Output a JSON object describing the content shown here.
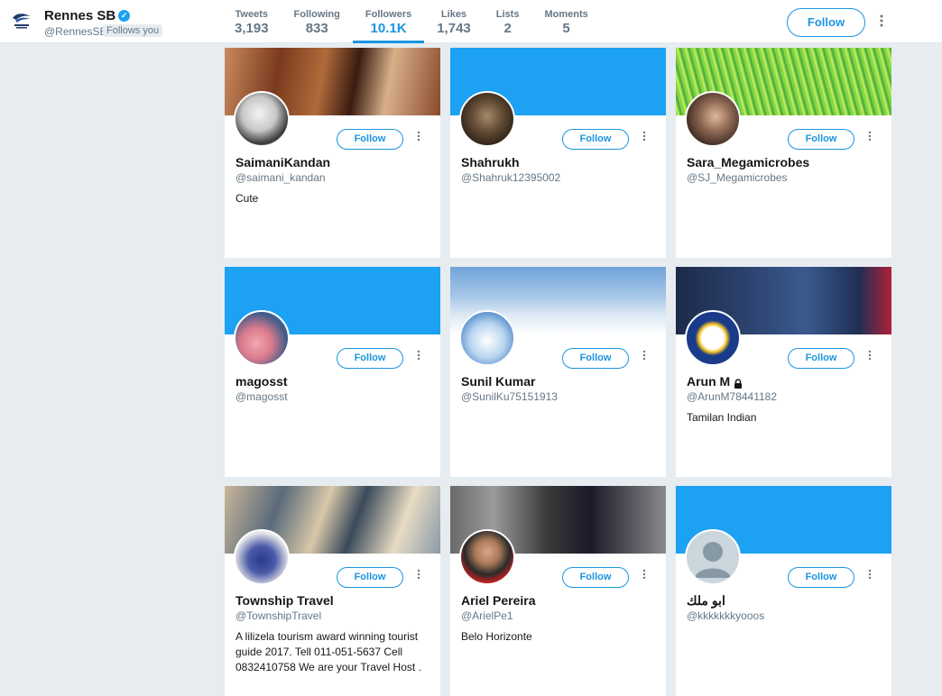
{
  "header": {
    "profile_name": "Rennes SB",
    "profile_handle": "@RennesSB",
    "follows_you": "Follows you",
    "follow_label": "Follow",
    "stats": [
      {
        "label": "Tweets",
        "value": "3,193"
      },
      {
        "label": "Following",
        "value": "833"
      },
      {
        "label": "Followers",
        "value": "10.1K"
      },
      {
        "label": "Likes",
        "value": "1,743"
      },
      {
        "label": "Lists",
        "value": "2"
      },
      {
        "label": "Moments",
        "value": "5"
      }
    ],
    "active_stat": "Followers"
  },
  "colors": {
    "accent": "#1b95e0",
    "default_banner": "#1da1f2",
    "page_bg": "#e6ecf0"
  },
  "cards": [
    {
      "name": "SaimaniKandan",
      "handle": "@saimani_kandan",
      "bio": "Cute",
      "follow": "Follow",
      "locked": false
    },
    {
      "name": "Shahrukh",
      "handle": "@Shahruk12395002",
      "bio": "",
      "follow": "Follow",
      "locked": false
    },
    {
      "name": "Sara_Megamicrobes",
      "handle": "@SJ_Megamicrobes",
      "bio": "",
      "follow": "Follow",
      "locked": false
    },
    {
      "name": "magosst",
      "handle": "@magosst",
      "bio": "",
      "follow": "Follow",
      "locked": false
    },
    {
      "name": "Sunil Kumar",
      "handle": "@SunilKu75151913",
      "bio": "",
      "follow": "Follow",
      "locked": false
    },
    {
      "name": "Arun M",
      "handle": "@ArunM78441182",
      "bio": "Tamilan Indian",
      "follow": "Follow",
      "locked": true
    },
    {
      "name": "Township Travel",
      "handle": "@TownshipTravel",
      "bio": "A lilizela tourism award winning tourist guide 2017. Tell 011-051-5637 Cell 0832410758 We are your Travel Host .",
      "follow": "Follow",
      "locked": false
    },
    {
      "name": "Ariel Pereira",
      "handle": "@ArielPe1",
      "bio": "Belo Horizonte",
      "follow": "Follow",
      "locked": false
    },
    {
      "name": "ابو ملك",
      "handle": "@kkkkkkkyooos",
      "bio": "",
      "follow": "Follow",
      "locked": false
    }
  ]
}
